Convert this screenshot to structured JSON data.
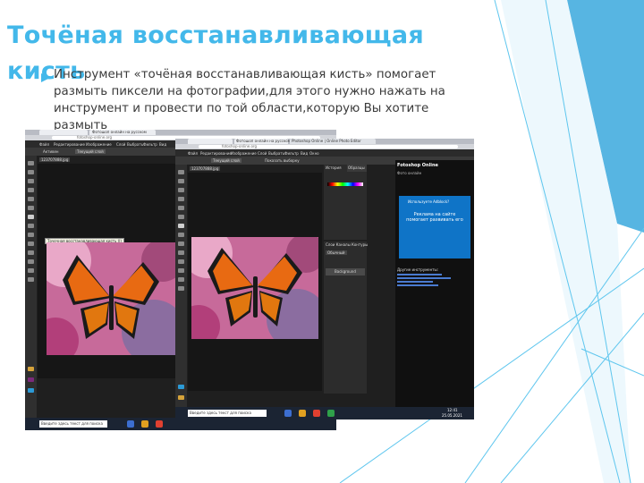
{
  "slide": {
    "title": "Точёная восстанавливающая кисть",
    "body": "Инструмент «точёная восстанавливающая  кисть» помогает размыть пиксели на фотографии,для этого нужно нажать на инструмент и провести по той области,которую Вы хотите размыть"
  },
  "theme": {
    "title_color": "#43b8ea",
    "bullet_color": "#43b8ea",
    "deco_lines": "#5ec6ee",
    "deco_fill": "#3aa8dd"
  },
  "screenshot_back": {
    "tab_label": "Фотошоп онлайн на русском",
    "address": "fotoshop-online.org",
    "menu": [
      "Файл",
      "Редактирование",
      "Изображение",
      "Слой",
      "Выбрать",
      "Фильтр",
      "Вид",
      "Окно",
      "Тема",
      "Проектор"
    ],
    "option_label": "Активен",
    "option_select": "Текущий слой",
    "doc_tab": "123707888.jpg",
    "tooltip": "Точечная восстанавливающая кисть (J)",
    "taskbar_search": "Введите здесь текст для поиска"
  },
  "screenshot_front": {
    "tab_label": "Фотошоп онлайн на русском",
    "tab_label_2": "Photoshop Online | Online Photo Editor",
    "address": "fotoshop-online.org",
    "menu": [
      "Файл",
      "Редактирование",
      "Изображение",
      "Слой",
      "Выбрать",
      "Фильтр",
      "Вид",
      "Окно",
      "Тема",
      "Проектор"
    ],
    "option_select": "Текущий слой",
    "option_extra": "Показать выборку",
    "doc_tab": "123707888.jpg",
    "panels": {
      "history": "История",
      "swatches": "Образцы",
      "layers_tabs": "Слои  Каналы  Контуры",
      "blend": "Обычный",
      "layer_name": "Background"
    },
    "sidebar": {
      "site_title": "Fotoshop Online",
      "site_sub": "Фото онлайн",
      "adblock_head": "Используете Adblock?",
      "adblock_main": "Реклама на сайте помогает развивать его",
      "tools_head": "Другие инструменты:"
    },
    "taskbar_search": "Введите здесь текст для поиска",
    "clock_time": "12:41",
    "clock_date": "25.05.2021"
  }
}
